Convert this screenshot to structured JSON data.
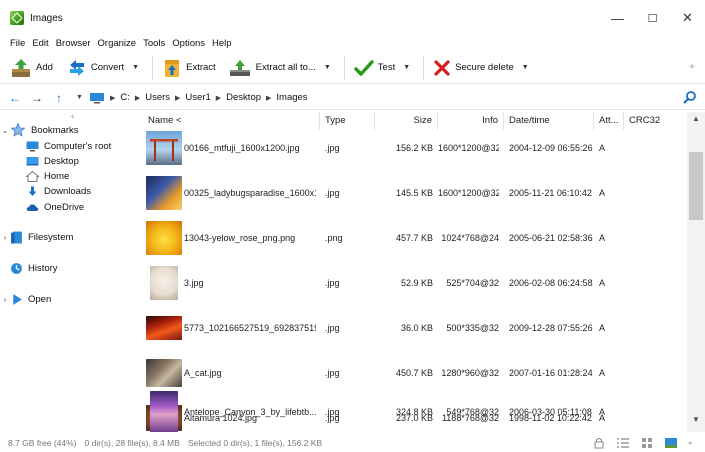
{
  "window": {
    "title": "Images",
    "controls": [
      "—",
      "☐",
      "✕"
    ]
  },
  "menu": [
    "File",
    "Edit",
    "Browser",
    "Organize",
    "Tools",
    "Options",
    "Help"
  ],
  "toolbar": {
    "add": "Add",
    "convert": "Convert",
    "extract": "Extract",
    "extract_all": "Extract all to...",
    "test": "Test",
    "secure_delete": "Secure delete",
    "plus": "+"
  },
  "address": {
    "crumbs": [
      "C:",
      "Users",
      "User1",
      "Desktop",
      "Images"
    ]
  },
  "sidebar": {
    "bookmarks": "Bookmarks",
    "computer_root": "Computer's root",
    "desktop": "Desktop",
    "home": "Home",
    "downloads": "Downloads",
    "onedrive": "OneDrive",
    "filesystem": "Filesystem",
    "history": "History",
    "open": "Open"
  },
  "columns": {
    "name": "Name <",
    "type": "Type",
    "size": "Size",
    "info": "Info",
    "date": "Date/time",
    "attr": "Att...",
    "crc": "CRC32"
  },
  "files": [
    {
      "name": "00166_mtfuji_1600x1200.jpg",
      "type": ".jpg",
      "size": "156.2 KB",
      "info": "1600*1200@32",
      "date": "2004-12-09 06:55:26",
      "attr": "A"
    },
    {
      "name": "00325_ladybugsparadise_1600x1...",
      "type": ".jpg",
      "size": "145.5 KB",
      "info": "1600*1200@32",
      "date": "2005-11-21 06:10:42",
      "attr": "A"
    },
    {
      "name": "13043-yelow_rose_png.png",
      "type": ".png",
      "size": "457.7 KB",
      "info": "1024*768@24",
      "date": "2005-06-21 02:58:36",
      "attr": "A"
    },
    {
      "name": "3.jpg",
      "type": ".jpg",
      "size": "52.9 KB",
      "info": "525*704@32",
      "date": "2006-02-08 06:24:58",
      "attr": "A"
    },
    {
      "name": "5773_102166527519_692837519_...",
      "type": ".jpg",
      "size": "36.0 KB",
      "info": "500*335@32",
      "date": "2009-12-28 07:55:26",
      "attr": "A"
    },
    {
      "name": "A_cat.jpg",
      "type": ".jpg",
      "size": "450.7 KB",
      "info": "1280*960@32",
      "date": "2007-01-16 01:28:24",
      "attr": "A"
    },
    {
      "name": "Altamura 1024.jpg",
      "type": ".jpg",
      "size": "237.0 KB",
      "info": "1188*768@32",
      "date": "1998-11-02 10:22:42",
      "attr": "A"
    },
    {
      "name": "Antelope_Canyon_3_by_lifebtb....",
      "type": ".jpg",
      "size": "324.8 KB",
      "info": "549*768@32",
      "date": "2006-03-30 05:11:08",
      "attr": "A"
    }
  ],
  "status": {
    "free": "8.7 GB free (44%)",
    "totals": "0 dir(s), 28 file(s), 8.4 MB",
    "selected": "Selected 0 dir(s), 1 file(s), 156.2 KB"
  },
  "colors": {
    "accent_blue": "#1a6ec2",
    "check_green": "#2a9a1a",
    "delete_red": "#d42020"
  }
}
